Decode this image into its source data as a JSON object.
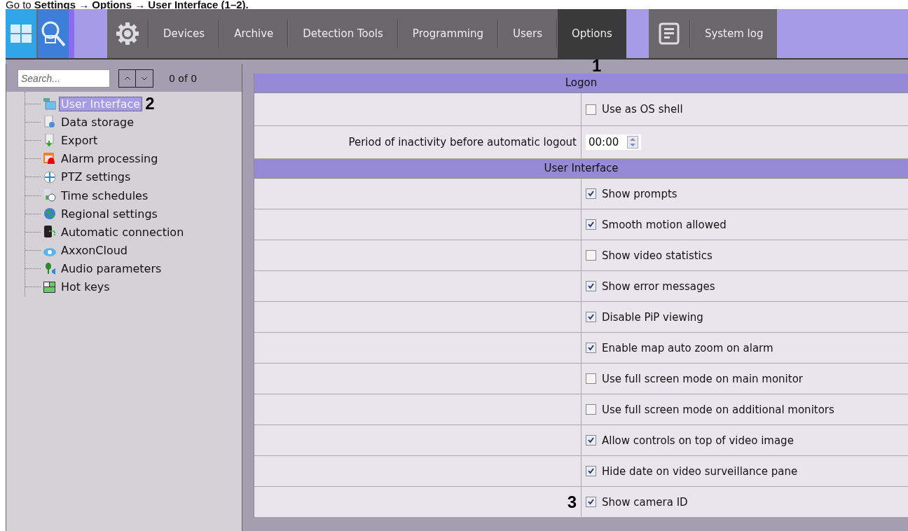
{
  "caption": "Go to **Settings → Options → User Interface (1–2).**",
  "toolbar": {
    "tabs": [
      {
        "label": "Devices",
        "selected": false
      },
      {
        "label": "Archive",
        "selected": false
      },
      {
        "label": "Detection Tools",
        "selected": false
      },
      {
        "label": "Programming",
        "selected": false
      },
      {
        "label": "Users",
        "selected": false
      },
      {
        "label": "Options",
        "selected": true,
        "callout": "1"
      }
    ],
    "system_log": "System log"
  },
  "tree": {
    "search_placeholder": "Search...",
    "counter": "0 of 0",
    "items": [
      {
        "label": "User Interface",
        "selected": true,
        "callout": "2"
      },
      {
        "label": "Data storage",
        "selected": false
      },
      {
        "label": "Export",
        "selected": false
      },
      {
        "label": "Alarm processing",
        "selected": false
      },
      {
        "label": "PTZ settings",
        "selected": false
      },
      {
        "label": "Time schedules",
        "selected": false
      },
      {
        "label": "Regional settings",
        "selected": false
      },
      {
        "label": "Automatic connection",
        "selected": false
      },
      {
        "label": "AxxonCloud",
        "selected": false
      },
      {
        "label": "Audio parameters",
        "selected": false
      },
      {
        "label": "Hot keys",
        "selected": false
      }
    ]
  },
  "sections": [
    {
      "title": "Logon",
      "rows": [
        {
          "kind": "checkbox",
          "text": "Use as OS shell",
          "checked": false
        },
        {
          "kind": "time",
          "label": "Period of inactivity before automatic logout",
          "value": "00:00"
        }
      ]
    },
    {
      "title": "User Interface",
      "rows": [
        {
          "kind": "checkbox",
          "text": "Show prompts",
          "checked": true
        },
        {
          "kind": "checkbox",
          "text": "Smooth motion allowed",
          "checked": true
        },
        {
          "kind": "checkbox",
          "text": "Show video statistics",
          "checked": false
        },
        {
          "kind": "checkbox",
          "text": "Show error messages",
          "checked": true
        },
        {
          "kind": "checkbox",
          "text": "Disable PiP viewing",
          "checked": true
        },
        {
          "kind": "checkbox",
          "text": "Enable map auto zoom on alarm",
          "checked": true
        },
        {
          "kind": "checkbox",
          "text": "Use full screen mode on main monitor",
          "checked": false
        },
        {
          "kind": "checkbox",
          "text": "Use full screen mode on additional monitors",
          "checked": false
        },
        {
          "kind": "checkbox",
          "text": "Allow controls on top of video image",
          "checked": true
        },
        {
          "kind": "checkbox",
          "text": "Hide date on video surveillance pane",
          "checked": true
        },
        {
          "kind": "checkbox",
          "text": "Show camera ID",
          "checked": true,
          "callout": "3"
        }
      ]
    }
  ]
}
